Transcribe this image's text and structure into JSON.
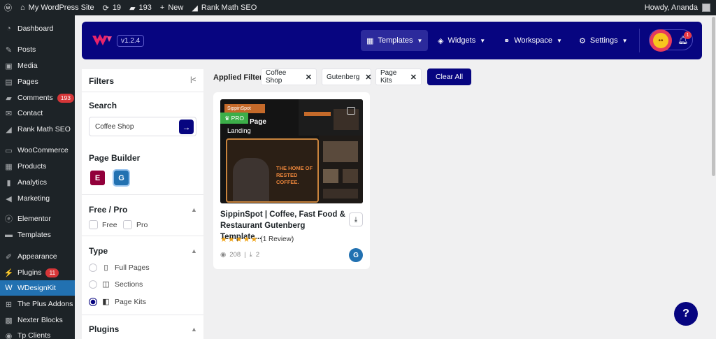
{
  "adminbar": {
    "site_name": "My WordPress Site",
    "updates_count": "19",
    "comments_count": "193",
    "new_label": "New",
    "seo_label": "Rank Math SEO",
    "howdy": "Howdy, Ananda"
  },
  "sidebar": {
    "items": [
      {
        "label": "Dashboard",
        "icon": "dashboard-icon"
      },
      {
        "label": "Posts",
        "icon": "pin-icon"
      },
      {
        "label": "Media",
        "icon": "media-icon"
      },
      {
        "label": "Pages",
        "icon": "pages-icon"
      },
      {
        "label": "Comments",
        "icon": "comment-icon",
        "badge": "193"
      },
      {
        "label": "Contact",
        "icon": "mail-icon"
      },
      {
        "label": "Rank Math SEO",
        "icon": "chart-icon"
      },
      {
        "label": "WooCommerce",
        "icon": "woo-icon"
      },
      {
        "label": "Products",
        "icon": "archive-icon"
      },
      {
        "label": "Analytics",
        "icon": "bar-chart-icon"
      },
      {
        "label": "Marketing",
        "icon": "megaphone-icon"
      },
      {
        "label": "Elementor",
        "icon": "elementor-icon"
      },
      {
        "label": "Templates",
        "icon": "folder-icon"
      },
      {
        "label": "Appearance",
        "icon": "brush-icon"
      },
      {
        "label": "Plugins",
        "icon": "plugin-icon",
        "badge": "11"
      },
      {
        "label": "WDesignKit",
        "icon": "wdesignkit-icon",
        "active": true
      },
      {
        "label": "The Plus Addons",
        "icon": "plus-grid-icon"
      },
      {
        "label": "Nexter Blocks",
        "icon": "blocks-icon"
      },
      {
        "label": "Tp Clients",
        "icon": "clients-icon"
      }
    ]
  },
  "header": {
    "version": "v1.2.4",
    "nav": {
      "templates": "Templates",
      "widgets": "Widgets",
      "workspace": "Workspace",
      "settings": "Settings"
    },
    "notification_count": "1",
    "accent": "#070580"
  },
  "filters": {
    "title": "Filters",
    "search": {
      "title": "Search",
      "value": "Coffee Shop"
    },
    "page_builder": {
      "title": "Page Builder",
      "elementor": "E",
      "gutenberg": "G"
    },
    "free_pro": {
      "title": "Free / Pro",
      "free": "Free",
      "pro": "Pro"
    },
    "type": {
      "title": "Type",
      "full_pages": "Full Pages",
      "sections": "Sections",
      "page_kits": "Page Kits"
    },
    "plugins": {
      "title": "Plugins"
    }
  },
  "applied": {
    "label": "Applied Filter :",
    "chips": [
      "Coffee Shop",
      "Gutenberg",
      "Page Kits"
    ],
    "clear_all": "Clear All"
  },
  "card": {
    "thumb": {
      "logo": "SippinSpot",
      "pro": "PRO",
      "line1": "Page",
      "line2": "Landing",
      "hero": "THE HOME OF RESTED COFFEE."
    },
    "title": "SippinSpot | Coffee, Fast Food & Restaurant Gutenberg Template...",
    "rating": 5,
    "reviews": "(1 Review)",
    "views": "208",
    "downloads": "2",
    "builder_badge": "G"
  },
  "help": "?"
}
